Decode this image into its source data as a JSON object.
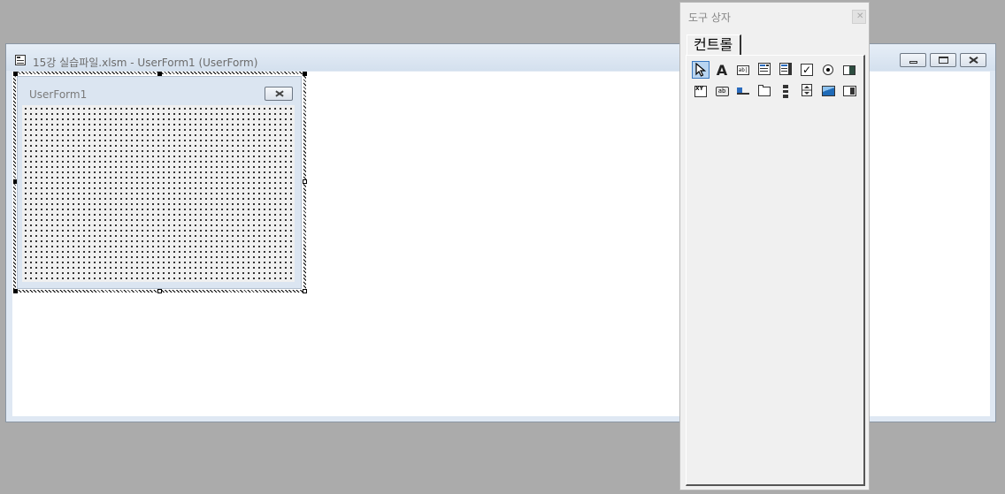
{
  "designer": {
    "title": "15강 실습파일.xlsm - UserForm1 (UserForm)",
    "icon": "form-icon"
  },
  "userform": {
    "caption": "UserForm1"
  },
  "toolbox": {
    "title": "도구 상자",
    "tab_label": "컨트롤",
    "tools": [
      {
        "name": "select-objects",
        "icon": "pointer-icon"
      },
      {
        "name": "label",
        "icon": "label-a-icon",
        "glyph": "A"
      },
      {
        "name": "textbox",
        "icon": "textbox-icon",
        "glyph": "ab|"
      },
      {
        "name": "combobox",
        "icon": "combobox-icon"
      },
      {
        "name": "listbox",
        "icon": "listbox-icon"
      },
      {
        "name": "checkbox",
        "icon": "checkbox-icon",
        "glyph": "✓"
      },
      {
        "name": "optionbutton",
        "icon": "radio-icon"
      },
      {
        "name": "togglebutton",
        "icon": "toggle-icon"
      },
      {
        "name": "frame",
        "icon": "frame-icon",
        "glyph": "XY"
      },
      {
        "name": "commandbutton",
        "icon": "command-button-icon",
        "glyph": "ab"
      },
      {
        "name": "tabstrip",
        "icon": "tabstrip-icon"
      },
      {
        "name": "multipage",
        "icon": "multipage-icon"
      },
      {
        "name": "scrollbar",
        "icon": "scrollbar-icon"
      },
      {
        "name": "spinbutton",
        "icon": "spinbutton-icon"
      },
      {
        "name": "image",
        "icon": "image-icon"
      },
      {
        "name": "refedit",
        "icon": "refedit-icon"
      }
    ]
  },
  "colors": {
    "background": "#ababab",
    "selected_tool": "#b9d5f1",
    "title_text": "#6b6b6b"
  }
}
